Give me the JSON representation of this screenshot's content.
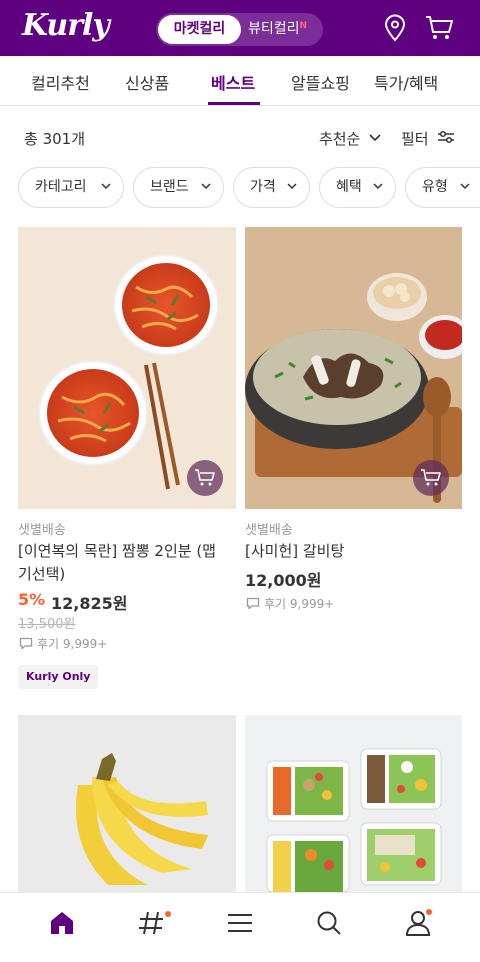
{
  "header": {
    "logo": "Kurly",
    "switch_market": "마켓컬리",
    "switch_beauty": "뷰티컬리",
    "beauty_new_badge": "N",
    "icons": [
      "location-pin-icon",
      "cart-icon"
    ]
  },
  "tabs": [
    {
      "label": "컬리추천",
      "active": false
    },
    {
      "label": "신상품",
      "active": false
    },
    {
      "label": "베스트",
      "active": true
    },
    {
      "label": "알뜰쇼핑",
      "active": false
    },
    {
      "label": "특가/혜택",
      "active": false
    }
  ],
  "list_bar": {
    "count": "총 301개",
    "sort_label": "추천순",
    "filter_label": "필터"
  },
  "filter_chips": [
    "카테고리",
    "브랜드",
    "가격",
    "혜택",
    "유형"
  ],
  "products": [
    {
      "delivery": "샛별배송",
      "name": "[이연복의 목란] 짬뽕 2인분 (맵기선택)",
      "name_line1": "[이연복의 목란] 짬뽕 2인분 (맵",
      "name_line2": "기선택)",
      "discount": "5%",
      "price": "12,825원",
      "original_price": "13,500원",
      "review": "후기 9,999+",
      "badge": "Kurly Only"
    },
    {
      "delivery": "샛별배송",
      "name": "[사미헌] 갈비탕",
      "price": "12,000원",
      "review": "후기 9,999+"
    }
  ],
  "bottom_nav": [
    "home-icon",
    "hashtag-icon",
    "menu-icon",
    "search-icon",
    "my-page-icon"
  ],
  "colors": {
    "brand": "#5f0080",
    "discount": "#fa622f",
    "notification_dot": "#fa622f"
  }
}
